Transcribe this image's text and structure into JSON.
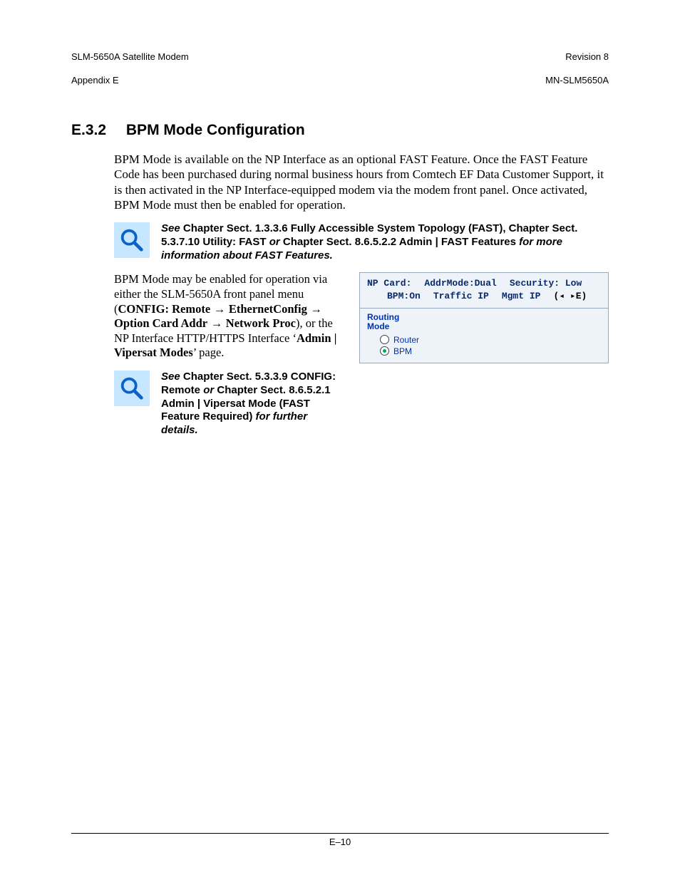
{
  "header": {
    "left_line1": "SLM-5650A Satellite Modem",
    "left_line2": "Appendix E",
    "right_line1": "Revision 8",
    "right_line2": "MN-SLM5650A"
  },
  "section": {
    "number": "E.3.2",
    "title": "BPM Mode Configuration"
  },
  "para1": "BPM Mode is available on the NP Interface as an optional FAST Feature. Once the FAST Feature Code has been purchased during normal business hours from Comtech EF Data Customer Support, it is then activated in the NP Interface-equipped modem via the modem front panel. Once activated, BPM Mode must then be enabled for operation.",
  "note1": {
    "see": "See",
    "part1": " Chapter Sect. 1.3.3.6 Fully Accessible System Topology (FAST), Chapter Sect. 5.3.7.10 Utility: FAST ",
    "or": "or",
    "part2": " Chapter Sect. 8.6.5.2.2 Admin | FAST Features ",
    "for": "for more information about FAST Features."
  },
  "para2": {
    "intro": "BPM Mode may be enabled for operation via either the SLM-5650A front panel menu (",
    "path_parts": [
      "CONFIG: Remote",
      "EthernetConfig",
      "Option Card Addr",
      "Network Proc"
    ],
    "arrow": " → ",
    "mid": "), or the NP Interface HTTP/HTTPS Interface ‘",
    "admin": "Admin | Vipersat Modes",
    "end": "’ page."
  },
  "note2": {
    "see": "See",
    "part1": " Chapter Sect. 5.3.3.9 CONFIG: Remote ",
    "or": "or",
    "part2": " Chapter Sect. 8.6.5.2.1 Admin | Vipersat Mode (FAST Feature Required) ",
    "for": "for further details."
  },
  "panel": {
    "lcd": {
      "r1c1": "NP Card:",
      "r1c2": "AddrMode:Dual",
      "r1c3": "Security: Low",
      "r2c1": "BPM:On",
      "r2c2": "Traffic IP",
      "r2c3": "Mgmt IP",
      "r2nav": "(◂ ▸E)"
    },
    "legend_l1": "Routing",
    "legend_l2": "Mode",
    "options": [
      {
        "label": "Router",
        "checked": false
      },
      {
        "label": "BPM",
        "checked": true
      }
    ]
  },
  "footer": {
    "page": "E–10"
  }
}
